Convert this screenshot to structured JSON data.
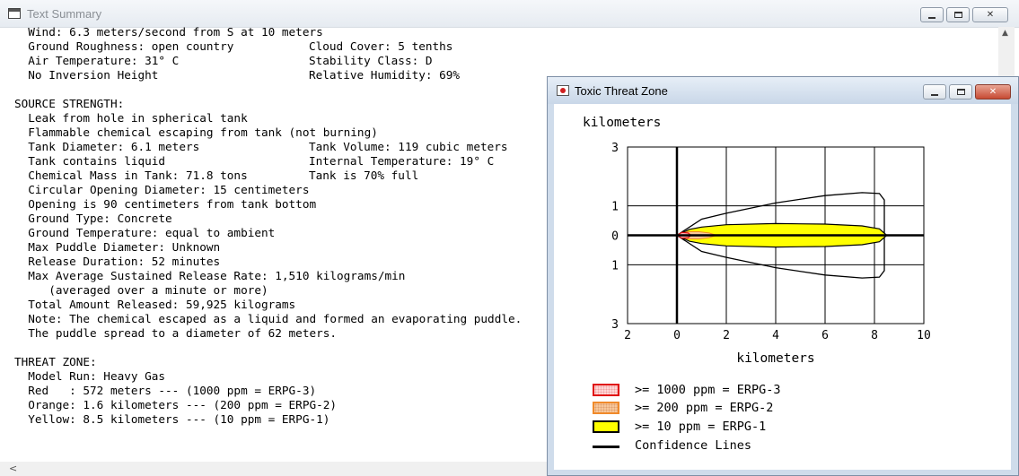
{
  "text_summary": {
    "title": "Text Summary",
    "lines": [
      {
        "a": "Wind: 6.3 meters/second from S at 10 meters",
        "b": ""
      },
      {
        "a": "Ground Roughness: open country",
        "b": "Cloud Cover: 5 tenths"
      },
      {
        "a": "Air Temperature: 31° C",
        "b": "Stability Class: D"
      },
      {
        "a": "No Inversion Height",
        "b": "Relative Humidity: 69%"
      },
      {
        "a": "",
        "b": ""
      },
      {
        "a": "SOURCE STRENGTH:",
        "b": "",
        "heading": true
      },
      {
        "a": "Leak from hole in spherical tank",
        "b": ""
      },
      {
        "a": "Flammable chemical escaping from tank (not burning)",
        "b": ""
      },
      {
        "a": "Tank Diameter: 6.1 meters",
        "b": "Tank Volume: 119 cubic meters"
      },
      {
        "a": "Tank contains liquid",
        "b": "Internal Temperature: 19° C"
      },
      {
        "a": "Chemical Mass in Tank: 71.8 tons",
        "b": "Tank is 70% full"
      },
      {
        "a": "Circular Opening Diameter: 15 centimeters",
        "b": ""
      },
      {
        "a": "Opening is 90 centimeters from tank bottom",
        "b": ""
      },
      {
        "a": "Ground Type: Concrete",
        "b": ""
      },
      {
        "a": "Ground Temperature: equal to ambient",
        "b": ""
      },
      {
        "a": "Max Puddle Diameter: Unknown",
        "b": ""
      },
      {
        "a": "Release Duration: 52 minutes",
        "b": ""
      },
      {
        "a": "Max Average Sustained Release Rate: 1,510 kilograms/min",
        "b": ""
      },
      {
        "a": "   (averaged over a minute or more)",
        "b": ""
      },
      {
        "a": "Total Amount Released: 59,925 kilograms",
        "b": ""
      },
      {
        "a": "Note: The chemical escaped as a liquid and formed an evaporating puddle.",
        "b": ""
      },
      {
        "a": "The puddle spread to a diameter of 62 meters.",
        "b": ""
      },
      {
        "a": "",
        "b": ""
      },
      {
        "a": "THREAT ZONE:",
        "b": "",
        "heading": true
      },
      {
        "a": "Model Run: Heavy Gas",
        "b": ""
      },
      {
        "a": "Red   : 572 meters --- (1000 ppm = ERPG-3)",
        "b": ""
      },
      {
        "a": "Orange: 1.6 kilometers --- (200 ppm = ERPG-2)",
        "b": ""
      },
      {
        "a": "Yellow: 8.5 kilometers --- (10 ppm = ERPG-1)",
        "b": ""
      }
    ]
  },
  "toxic_threat_zone": {
    "title": "Toxic Threat Zone",
    "y_unit_label": "kilometers",
    "x_unit_label": "kilometers",
    "legend": [
      {
        "label": ">= 1000 ppm = ERPG-3",
        "fill": "#ffd6d6",
        "border": "#e01010"
      },
      {
        "label": ">= 200 ppm = ERPG-2",
        "fill": "#f7c79a",
        "border": "#f08a2a"
      },
      {
        "label": ">= 10 ppm = ERPG-1",
        "fill": "#ffff00",
        "border": "#000000"
      },
      {
        "label": "Confidence Lines",
        "line": "#000000"
      }
    ]
  },
  "chart_data": {
    "type": "area",
    "title": "",
    "xlabel": "kilometers",
    "ylabel": "kilometers",
    "xlim": [
      -2,
      10
    ],
    "ylim": [
      -3,
      3
    ],
    "x_ticks": [
      2,
      0,
      2,
      4,
      6,
      8,
      10
    ],
    "y_ticks": [
      3,
      1,
      0,
      1,
      3
    ],
    "x_tick_values": [
      -2,
      0,
      2,
      4,
      6,
      8,
      10
    ],
    "y_tick_values": [
      3,
      1,
      0,
      -1,
      -3
    ],
    "grid": true,
    "legend_position": "bottom",
    "series": [
      {
        "name": ">= 10 ppm = ERPG-1",
        "color": "#ffff00",
        "x": [
          0,
          0.5,
          1.0,
          2.0,
          4.0,
          6.0,
          7.5,
          8.2,
          8.5
        ],
        "y_half_width": [
          0,
          0.2,
          0.28,
          0.36,
          0.4,
          0.38,
          0.32,
          0.22,
          0
        ]
      },
      {
        "name": ">= 200 ppm = ERPG-2",
        "color": "#f08a2a",
        "x": [
          0,
          0.4,
          0.9,
          1.3,
          1.6
        ],
        "y_half_width": [
          0,
          0.12,
          0.12,
          0.08,
          0
        ]
      },
      {
        "name": ">= 1000 ppm = ERPG-3",
        "color": "#e01010",
        "x": [
          0,
          0.2,
          0.45,
          0.572
        ],
        "y_half_width": [
          0,
          0.1,
          0.08,
          0
        ]
      },
      {
        "name": "Confidence Lines",
        "color": "#000000",
        "x": [
          0,
          1.0,
          2.0,
          4.0,
          6.0,
          7.5,
          8.2,
          8.4,
          8.4
        ],
        "y_half_width": [
          0,
          0.55,
          0.75,
          1.1,
          1.35,
          1.45,
          1.42,
          1.2,
          0
        ]
      }
    ]
  }
}
